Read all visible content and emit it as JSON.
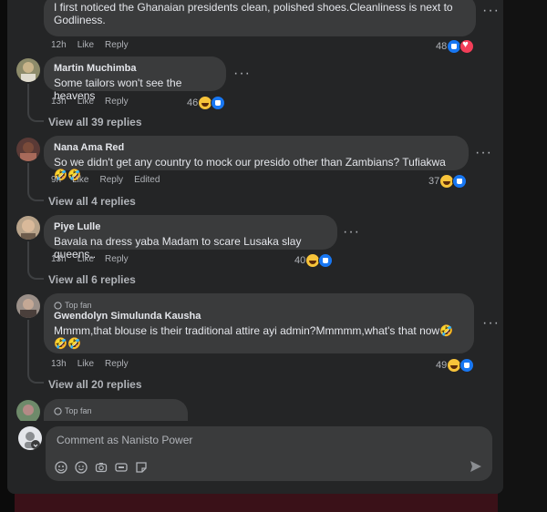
{
  "comments": [
    {
      "text": "I first noticed the Ghanaian presidents clean, polished shoes.Cleanliness is next to Godliness.",
      "time": "12h",
      "like": "Like",
      "reply": "Reply",
      "count": "48",
      "reactions": [
        "like",
        "love"
      ]
    },
    {
      "name": "Martin Muchimba",
      "text": "Some tailors won't see the heavens",
      "time": "13h",
      "like": "Like",
      "reply": "Reply",
      "count": "46",
      "reactions": [
        "haha",
        "like"
      ],
      "view_replies": "View all 39 replies"
    },
    {
      "name": "Nana Ama Red",
      "text": "So we didn't get any country to mock our presido other than Zambians? Tufiakwa🤣🤣",
      "time": "9h",
      "like": "Like",
      "reply": "Reply",
      "edited": "Edited",
      "count": "37",
      "reactions": [
        "haha",
        "like"
      ],
      "view_replies": "View all 4 replies"
    },
    {
      "name": "Piye Lulle",
      "text": "Bavala na dress yaba Madam to scare Lusaka slay queens..",
      "time": "13h",
      "like": "Like",
      "reply": "Reply",
      "count": "40",
      "reactions": [
        "haha",
        "like"
      ],
      "view_replies": "View all 6 replies"
    },
    {
      "badge": "Top fan",
      "name": "Gwendolyn Simulunda Kausha",
      "text": "Mmmm,that blouse is their traditional attire ayi admin?Mmmmm,what's that now🤣🤣🤣",
      "time": "13h",
      "like": "Like",
      "reply": "Reply",
      "count": "49",
      "reactions": [
        "haha",
        "like"
      ],
      "view_replies": "View all 20 replies"
    },
    {
      "badge": "Top fan"
    }
  ],
  "composer": {
    "placeholder": "Comment as Nanisto Power"
  },
  "icons": {
    "more": "more-options-icon",
    "avatar_sticker": "avatar-sticker-icon",
    "emoji": "emoji-icon",
    "camera": "camera-icon",
    "gif": "gif-icon",
    "sticker": "sticker-icon",
    "send": "send-icon"
  }
}
